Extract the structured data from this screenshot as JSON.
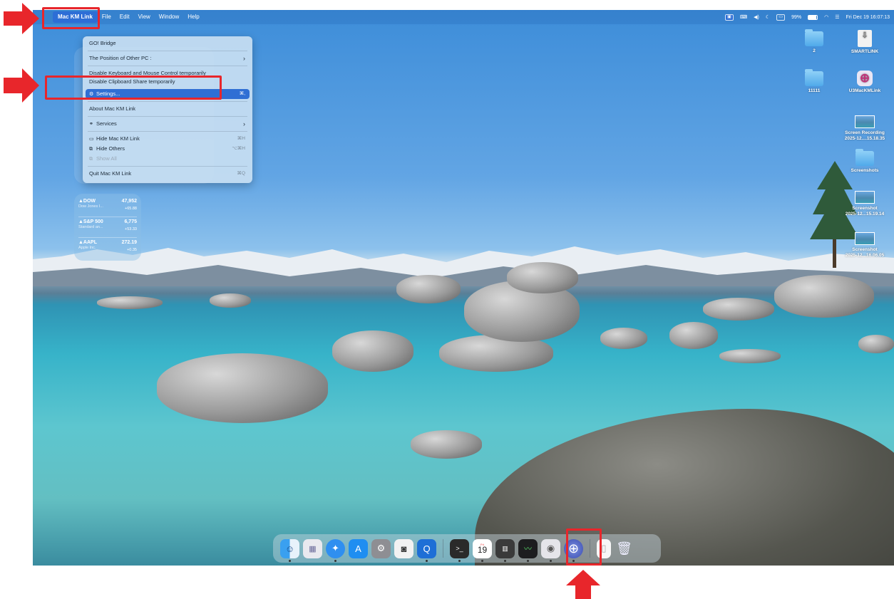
{
  "menubar": {
    "app_name": "Mac KM Link",
    "items": [
      "File",
      "Edit",
      "View",
      "Window",
      "Help"
    ],
    "battery": "99%",
    "clock": "Fri Dec 19  16:07:13"
  },
  "app_menu": {
    "items": [
      {
        "label": "GO! Bridge"
      },
      {
        "label": "The Position of Other PC :",
        "submenu": true
      },
      {
        "label": "Disable Keyboard and Mouse Control temporarily"
      },
      {
        "label": "Disable Clipboard Share temporarily"
      },
      {
        "label": "Settings...",
        "shortcut": "⌘,",
        "highlighted": true
      },
      {
        "label": "About Mac KM Link"
      },
      {
        "label": "Services",
        "submenu": true
      },
      {
        "label": "Hide Mac KM Link",
        "shortcut": "⌘H"
      },
      {
        "label": "Hide Others",
        "shortcut": "⌥⌘H"
      },
      {
        "label": "Show All",
        "disabled": true
      },
      {
        "label": "Quit Mac KM Link",
        "shortcut": "⌘Q"
      }
    ]
  },
  "stocks": [
    {
      "symbol": "▲DOW",
      "value": "47,952",
      "name": "Dow Jones I...",
      "change": "+65.88"
    },
    {
      "symbol": "▲S&P 500",
      "value": "6,775",
      "name": "Standard an...",
      "change": "+53.33"
    },
    {
      "symbol": "▲AAPL",
      "value": "272.19",
      "name": "Apple Inc.",
      "change": "+0.35"
    }
  ],
  "desktop_icons": [
    {
      "label": "2",
      "kind": "folder"
    },
    {
      "label": "SMARTLINK",
      "kind": "file"
    },
    {
      "label": "11111",
      "kind": "folder"
    },
    {
      "label": "U3MacKMLink",
      "kind": "app"
    },
    {
      "label": "Screen Recording",
      "label2": "2025-12....15.18.35",
      "kind": "thumb"
    },
    {
      "label": "Screenshots",
      "kind": "folder"
    },
    {
      "label": "Screenshot",
      "label2": "2025-12...15.19.14",
      "kind": "thumb"
    },
    {
      "label": "Screenshot",
      "label2": "2025-12...16.06.05",
      "kind": "thumb"
    }
  ],
  "dock": {
    "calendar_day": "19",
    "calendar_month": "Fri"
  },
  "colors": {
    "highlight": "#e8262b",
    "menu_selection": "#2f6fd4"
  }
}
